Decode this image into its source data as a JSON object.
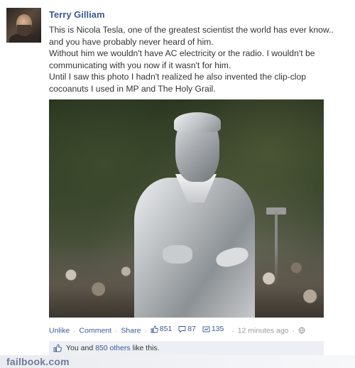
{
  "post": {
    "author": "Terry Gilliam",
    "paragraphs": [
      "This is Nicola Tesla, one of the greatest scientist the world has ever know.. and you have probably never heard of him.",
      "Without him we wouldn't have AC electricity or the radio. I wouldn't be communicating with you now if it wasn't for him.",
      "Until I saw this photo I hadn't realized he also invented the clip-clop cocoanuts I used in MP and The Holy Grail."
    ]
  },
  "actions": {
    "unlike": "Unlike",
    "comment": "Comment",
    "share": "Share",
    "separator": "·",
    "like_count": "851",
    "comment_count": "87",
    "share_count": "135",
    "timestamp": "12 minutes ago"
  },
  "likes_bar": {
    "you_and": "You and",
    "others_link": "850 others",
    "suffix": "like this."
  },
  "watermark": "failbook.com",
  "colors": {
    "link_blue": "#3b5998",
    "likes_box_bg": "#edeff4",
    "muted_text": "#999999"
  },
  "icons": {
    "like": "thumbs-up-icon",
    "comment": "comment-bubble-icon",
    "share": "share-icon",
    "privacy": "globe-icon"
  }
}
